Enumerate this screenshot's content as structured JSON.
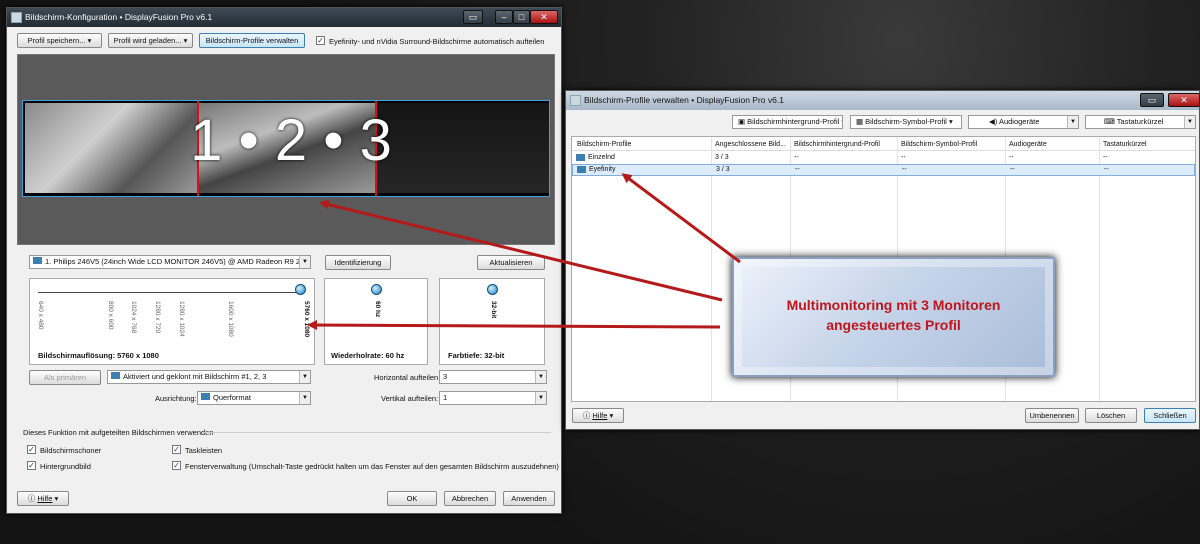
{
  "win1": {
    "title": "Bildschirm-Konfiguration • DisplayFusion Pro v6.1",
    "btn_save_profile": "Profil speichern...",
    "btn_load_profile": "Profil wird geladen...",
    "btn_manage_profiles": "Bildschirm-Profile verwalten",
    "chk_eyefinity": "Eyefinity- und nVidia Surround-Bildschirme automatisch aufteilen",
    "preview_text": "1 • 2 • 3",
    "monitor_select": "1. Philips 246V5 (24inch Wide LCD MONITOR 246V5) @ AMD Radeon R9 20...",
    "btn_identify": "Identifizierung",
    "btn_refresh": "Aktualisieren",
    "res_ticks": [
      "640 x 480",
      "800 x 600",
      "1024 x 768",
      "1280 x 720",
      "1280 x 1024",
      "1600 x 1080",
      "5760 x 1080"
    ],
    "res_label": "Bildschirmauflösung: 5760 x 1080",
    "hz_tick": "60 hz",
    "hz_label": "Wiederholrate: 60 hz",
    "bit_tick": "32-bit",
    "bit_label": "Farbtiefe: 32-bit",
    "btn_primary": "Als primären",
    "mode_select": "Aktiviert und geklont mit Bildschirm #1, 2, 3",
    "horiz_label": "Horizontal aufteilen:",
    "horiz_value": "3",
    "orient_label": "Ausrichtung:",
    "orient_value": "Querformat",
    "vert_label": "Vertikal aufteilen:",
    "vert_value": "1",
    "section_label": "Dieses Funktion mit aufgeteilten Bildschirmen verwenden",
    "chk_screensaver": "Bildschirmschoner",
    "chk_taskbars": "Taskleisten",
    "chk_wallpaper": "Hintergrundbild",
    "chk_windowmgmt": "Fensterverwaltung (Umschalt-Taste gedrückt halten um das Fenster auf den gesamten Bildschirm auszudehnen)",
    "btn_help": "Hilfe",
    "btn_ok": "OK",
    "btn_cancel": "Abbrechen",
    "btn_apply": "Anwenden"
  },
  "win2": {
    "title": "Bildschirm-Profile verwalten • DisplayFusion Pro v6.1",
    "dd_wallpaper": "Bildschirmhintergrund-Profil",
    "dd_icon": "Bildschirm-Symbol-Profil",
    "dd_audio": "Audiogeräte",
    "dd_hotkey": "Tastaturkürzel",
    "columns": [
      "Bildschirm-Profile",
      "Angeschlossene Bild...",
      "Bildschirmhintergrund-Profil",
      "Bildschirm-Symbol-Profil",
      "Audiogeräte",
      "Tastaturkürzel"
    ],
    "rows": [
      [
        "Einzelnd",
        "3 / 3",
        "--",
        "--",
        "--",
        "--"
      ],
      [
        "Eyefinity",
        "3 / 3",
        "--",
        "--",
        "--",
        "--"
      ]
    ],
    "btn_help": "Hilfe",
    "btn_rename": "Umbenennen",
    "btn_delete": "Löschen",
    "btn_close": "Schließen"
  },
  "callout": {
    "line1": "Multimonitoring mit 3 Monitoren",
    "line2": "angesteuertes Profil",
    "color": "#c0161b"
  },
  "colors": {
    "arrow": "#b51a1a",
    "accent": "#3c7fb1"
  }
}
